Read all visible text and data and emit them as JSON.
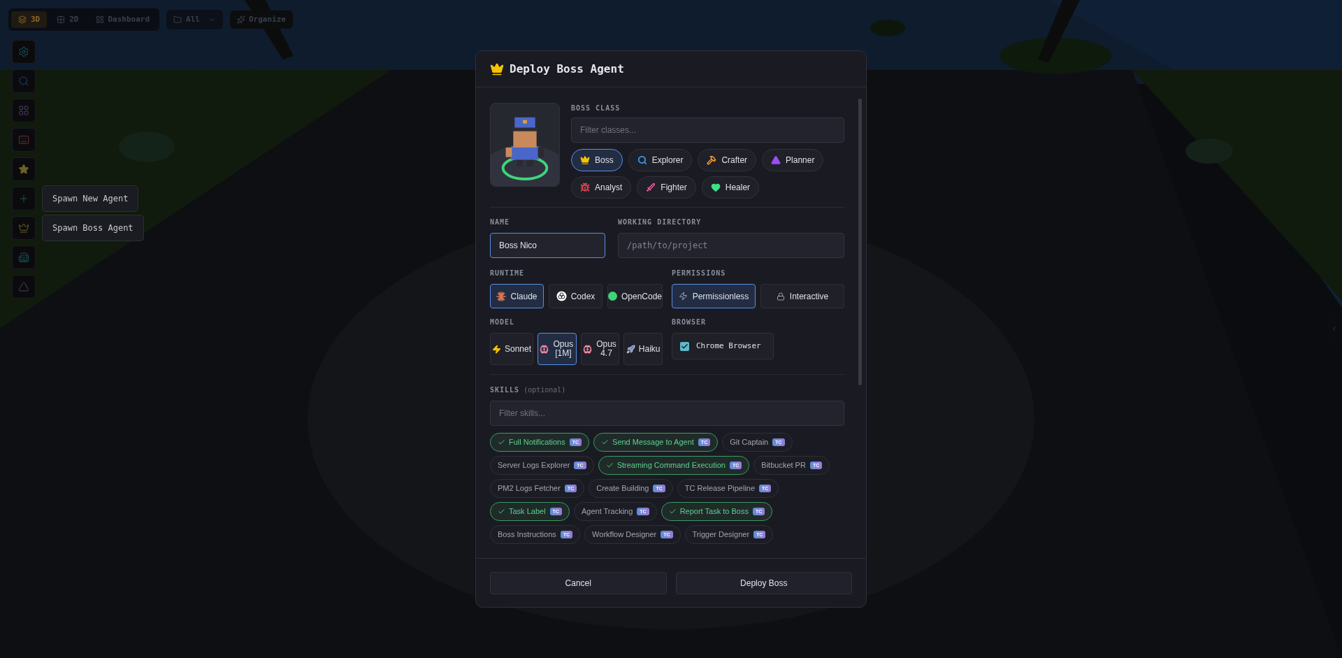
{
  "toolbar": {
    "views": [
      {
        "label": "3D",
        "selected": true
      },
      {
        "label": "2D",
        "selected": false
      },
      {
        "label": "Dashboard",
        "selected": false
      }
    ],
    "filter": "All",
    "organize": "Organize"
  },
  "tooltips": [
    "Spawn New Agent",
    "Spawn Boss Agent"
  ],
  "dialog": {
    "title": "Deploy Boss Agent",
    "boss_class": {
      "label": "BOSS CLASS",
      "placeholder": "Filter classes...",
      "classes": [
        {
          "label": "Boss",
          "selected": true
        },
        {
          "label": "Explorer",
          "selected": false
        },
        {
          "label": "Crafter",
          "selected": false
        },
        {
          "label": "Planner",
          "selected": false
        },
        {
          "label": "Analyst",
          "selected": false
        },
        {
          "label": "Fighter",
          "selected": false
        },
        {
          "label": "Healer",
          "selected": false
        }
      ]
    },
    "name": {
      "label": "NAME",
      "value": "Boss Nico"
    },
    "working_directory": {
      "label": "WORKING DIRECTORY",
      "placeholder": "/path/to/project"
    },
    "runtime": {
      "label": "RUNTIME",
      "options": [
        {
          "label": "Claude",
          "selected": true
        },
        {
          "label": "Codex",
          "selected": false
        },
        {
          "label": "OpenCode",
          "selected": false
        }
      ]
    },
    "permissions": {
      "label": "PERMISSIONS",
      "options": [
        {
          "label": "Permissionless",
          "selected": true
        },
        {
          "label": "Interactive",
          "selected": false
        }
      ]
    },
    "model": {
      "label": "MODEL",
      "options": [
        {
          "label": "Sonnet",
          "selected": false
        },
        {
          "label": "Opus [1M]",
          "selected": true
        },
        {
          "label": "Opus 4.7",
          "selected": false
        },
        {
          "label": "Haiku",
          "selected": false
        }
      ]
    },
    "browser": {
      "label": "BROWSER",
      "option": "Chrome Browser",
      "checked": true
    },
    "skills": {
      "label": "SKILLS",
      "hint": "(optional)",
      "placeholder": "Filter skills...",
      "items": [
        {
          "label": "Full Notifications",
          "badge": "TC",
          "checked": true
        },
        {
          "label": "Send Message to Agent",
          "badge": "TC",
          "checked": true
        },
        {
          "label": "Git Captain",
          "badge": "TC",
          "checked": false
        },
        {
          "label": "Server Logs Explorer",
          "badge": "TC",
          "checked": false
        },
        {
          "label": "Streaming Command Execution",
          "badge": "TC",
          "checked": true
        },
        {
          "label": "Bitbucket PR",
          "badge": "TC",
          "checked": false
        },
        {
          "label": "PM2 Logs Fetcher",
          "badge": "TC",
          "checked": false
        },
        {
          "label": "Create Building",
          "badge": "TC",
          "checked": false
        },
        {
          "label": "TC Release Pipeline",
          "badge": "TC",
          "checked": false
        },
        {
          "label": "Task Label",
          "badge": "TC",
          "checked": true
        },
        {
          "label": "Agent Tracking",
          "badge": "TC",
          "checked": false
        },
        {
          "label": "Report Task to Boss",
          "badge": "TC",
          "checked": true
        },
        {
          "label": "Boss Instructions",
          "badge": "TC",
          "checked": false
        },
        {
          "label": "Workflow Designer",
          "badge": "TC",
          "checked": false
        },
        {
          "label": "Trigger Designer",
          "badge": "TC",
          "checked": false
        }
      ]
    },
    "buttons": [
      "Cancel",
      "Deploy Boss"
    ]
  }
}
